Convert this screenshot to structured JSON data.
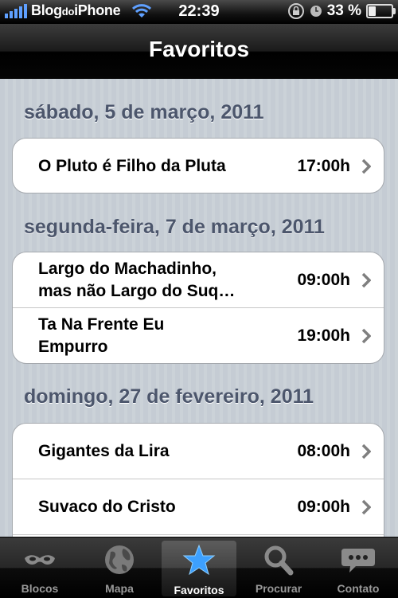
{
  "status_bar": {
    "carrier_prefix": "Blog",
    "carrier_small": "do",
    "carrier_suffix": "iPhone",
    "time": "22:39",
    "battery": "33 %",
    "battery_level": 0.33
  },
  "nav": {
    "title": "Favoritos"
  },
  "sections": [
    {
      "header": "sábado, 5 de março, 2011",
      "items": [
        {
          "name": "O Pluto é Filho da Pluta",
          "time": "17:00h"
        }
      ]
    },
    {
      "header": "segunda-feira, 7 de março, 2011",
      "items": [
        {
          "name": "Largo do Machadinho,\nmas não Largo do Suq…",
          "time": "09:00h"
        },
        {
          "name": "Ta Na Frente Eu\nEmpurro",
          "time": "19:00h"
        }
      ]
    },
    {
      "header": "domingo, 27 de fevereiro, 2011",
      "items": [
        {
          "name": "Gigantes da Lira",
          "time": "08:00h"
        },
        {
          "name": "Suvaco do Cristo",
          "time": "09:00h"
        }
      ]
    }
  ],
  "tabs": [
    {
      "label": "Blocos",
      "icon": "mask-icon"
    },
    {
      "label": "Mapa",
      "icon": "globe-icon"
    },
    {
      "label": "Favoritos",
      "icon": "star-icon",
      "active": true
    },
    {
      "label": "Procurar",
      "icon": "search-icon"
    },
    {
      "label": "Contato",
      "icon": "chat-bubble-icon"
    }
  ]
}
